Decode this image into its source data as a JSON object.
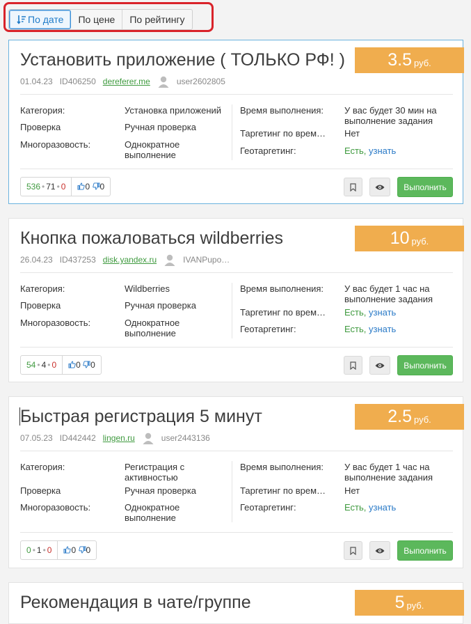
{
  "sort": {
    "options": [
      {
        "label": "По дате",
        "active": true
      },
      {
        "label": "По цене",
        "active": false
      },
      {
        "label": "По рейтингу",
        "active": false
      }
    ]
  },
  "labels": {
    "category": "Категория:",
    "check": "Проверка",
    "reusable": "Многоразовость:",
    "time": "Время выполнения:",
    "time_targeting": "Таргетинг по врем…",
    "geo": "Геотаргетинг:",
    "execute": "Выполнить",
    "currency": "руб."
  },
  "tasks": [
    {
      "title": "Установить приложение ( ТОЛЬКО РФ! )",
      "price": "3.5",
      "date": "01.04.23",
      "id": "ID406250",
      "domain": "dereferer.me",
      "user": "user2602805",
      "category": "Установка приложений",
      "check": "Ручная проверка",
      "reusable": "Однократное выполнение",
      "time": "У вас будет 30 мин на выполнение задания",
      "time_targeting": "Нет",
      "geo_yes": "Есть,",
      "geo_link": "узнать",
      "stats": {
        "green": "536",
        "dark": "71",
        "red": "0",
        "likes": "0",
        "dislikes": "0"
      }
    },
    {
      "title": "Кнопка пожаловаться wildberries",
      "price": "10",
      "date": "26.04.23",
      "id": "ID437253",
      "domain": "disk.yandex.ru",
      "user": "IVANPupo…",
      "category": "Wildberries",
      "check": "Ручная проверка",
      "reusable": "Однократное выполнение",
      "time": "У вас будет 1 час на выполнение задания",
      "time_targeting_yes": "Есть,",
      "time_targeting_link": "узнать",
      "geo_yes": "Есть,",
      "geo_link": "узнать",
      "stats": {
        "green": "54",
        "dark": "4",
        "red": "0",
        "likes": "0",
        "dislikes": "0"
      }
    },
    {
      "title": "Быстрая регистрация 5 минут",
      "price": "2.5",
      "date": "07.05.23",
      "id": "ID442442",
      "domain": "lingen.ru",
      "user": "user2443136",
      "category": "Регистрация с активностью",
      "check": "Ручная проверка",
      "reusable": "Однократное выполнение",
      "time": "У вас будет 1 час на выполнение задания",
      "time_targeting": "Нет",
      "geo_yes": "Есть,",
      "geo_link": "узнать",
      "stats": {
        "green": "0",
        "dark": "1",
        "red": "0",
        "likes": "0",
        "dislikes": "0"
      }
    },
    {
      "title": "Рекомендация в чате/группе",
      "price": "5"
    }
  ],
  "colors": {
    "price": "#f0ad4e",
    "execute": "#5cb85c",
    "highlight_outline": "#d9232a",
    "link": "#2a7ac7",
    "green": "#3f9a3f"
  }
}
